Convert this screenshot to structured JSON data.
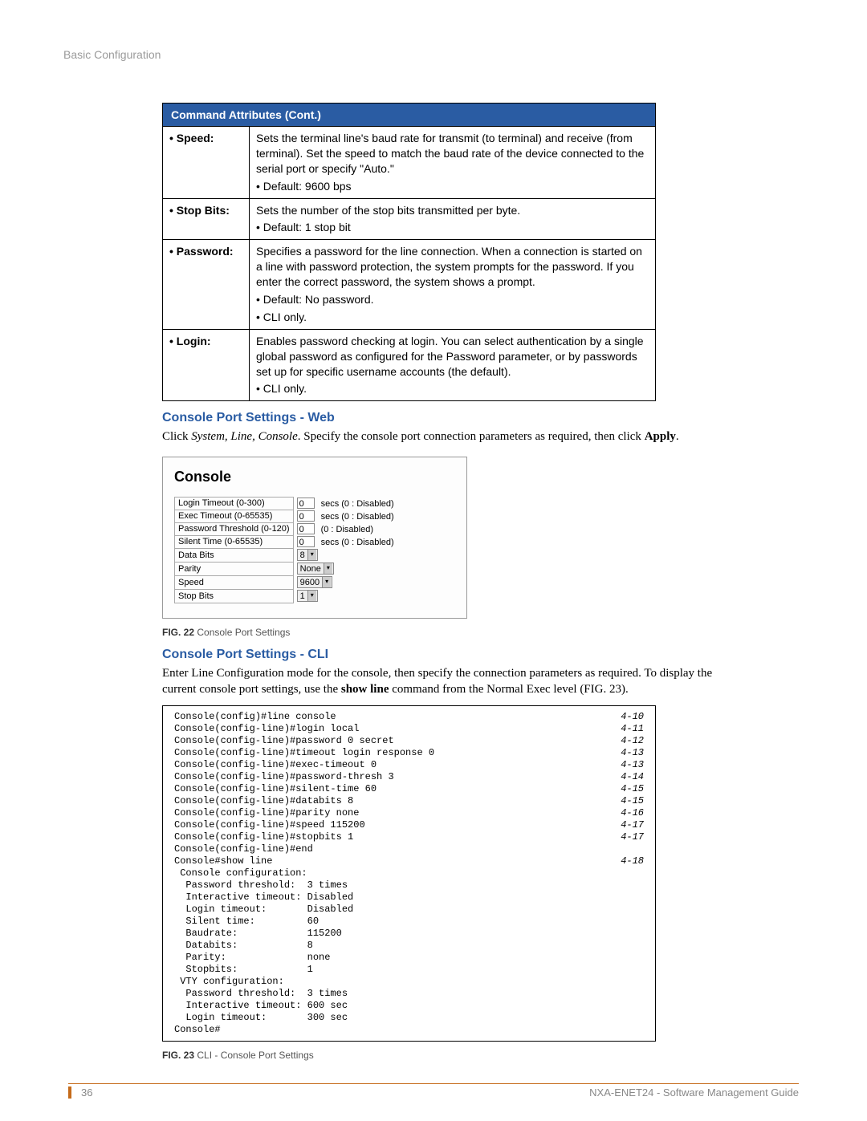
{
  "header": "Basic Configuration",
  "table_title": "Command Attributes (Cont.)",
  "rows": [
    {
      "label": "• Speed:",
      "desc": "Sets the terminal line's baud rate for transmit (to terminal) and receive (from terminal). Set the speed to match the baud rate of the device connected to the serial port or specify \"Auto.\"",
      "bul1": "• Default: 9600 bps",
      "bul2": ""
    },
    {
      "label": "• Stop Bits:",
      "desc": "Sets the number of the stop bits transmitted per byte.",
      "bul1": "• Default: 1 stop bit",
      "bul2": ""
    },
    {
      "label": "• Password:",
      "desc": "Specifies a password for the line connection. When a connection is started on a line with password protection, the system prompts for the password. If you enter the correct password, the system shows a prompt.",
      "bul1": "• Default: No password.",
      "bul2": "• CLI only."
    },
    {
      "label": "• Login:",
      "desc": "Enables password checking at login. You can select authentication by a single global password as configured for the Password parameter, or by passwords set up for specific username accounts (the default).",
      "bul1": "• CLI only.",
      "bul2": ""
    }
  ],
  "sec_web_title": "Console Port Settings - Web",
  "sec_web_body_pre": "Click ",
  "sec_web_body_ital": "System, Line, Console",
  "sec_web_body_post": ". Specify the console port connection parameters as required, then click ",
  "sec_web_body_bold": "Apply",
  "sec_web_body_end": ".",
  "console_title": "Console",
  "form": [
    {
      "label": "Login Timeout (0-300)",
      "val": "0",
      "suffix": "secs (0 : Disabled)",
      "type": "input"
    },
    {
      "label": "Exec Timeout (0-65535)",
      "val": "0",
      "suffix": "secs (0 : Disabled)",
      "type": "input"
    },
    {
      "label": "Password Threshold (0-120)",
      "val": "0",
      "suffix": "(0 : Disabled)",
      "type": "input"
    },
    {
      "label": "Silent Time (0-65535)",
      "val": "0",
      "suffix": "secs (0 : Disabled)",
      "type": "input"
    },
    {
      "label": "Data Bits",
      "val": "8",
      "suffix": "",
      "type": "select"
    },
    {
      "label": "Parity",
      "val": "None",
      "suffix": "",
      "type": "select"
    },
    {
      "label": "Speed",
      "val": "9600",
      "suffix": "",
      "type": "select"
    },
    {
      "label": "Stop Bits",
      "val": "1",
      "suffix": "",
      "type": "select"
    }
  ],
  "fig22_label": "FIG. 22",
  "fig22_text": "  Console Port Settings",
  "sec_cli_title": "Console Port Settings - CLI",
  "sec_cli_body_1": "Enter Line Configuration mode for the console, then specify the connection parameters as required. To display the current console port settings, use the ",
  "sec_cli_body_bold": "show line",
  "sec_cli_body_2": " command from the Normal Exec level (FIG. 23).",
  "cli": [
    {
      "cmd": "Console(config)#line console",
      "ref": "4-10"
    },
    {
      "cmd": "Console(config-line)#login local",
      "ref": "4-11"
    },
    {
      "cmd": "Console(config-line)#password 0 secret",
      "ref": "4-12"
    },
    {
      "cmd": "Console(config-line)#timeout login response 0",
      "ref": "4-13"
    },
    {
      "cmd": "Console(config-line)#exec-timeout 0",
      "ref": "4-13"
    },
    {
      "cmd": "Console(config-line)#password-thresh 3",
      "ref": "4-14"
    },
    {
      "cmd": "Console(config-line)#silent-time 60",
      "ref": "4-15"
    },
    {
      "cmd": "Console(config-line)#databits 8",
      "ref": "4-15"
    },
    {
      "cmd": "Console(config-line)#parity none",
      "ref": "4-16"
    },
    {
      "cmd": "Console(config-line)#speed 115200",
      "ref": "4-17"
    },
    {
      "cmd": "Console(config-line)#stopbits 1",
      "ref": "4-17"
    },
    {
      "cmd": "Console(config-line)#end",
      "ref": ""
    },
    {
      "cmd": "Console#show line",
      "ref": "4-18"
    },
    {
      "cmd": " Console configuration:",
      "ref": ""
    },
    {
      "cmd": "  Password threshold:  3 times",
      "ref": ""
    },
    {
      "cmd": "  Interactive timeout: Disabled",
      "ref": ""
    },
    {
      "cmd": "  Login timeout:       Disabled",
      "ref": ""
    },
    {
      "cmd": "  Silent time:         60",
      "ref": ""
    },
    {
      "cmd": "  Baudrate:            115200",
      "ref": ""
    },
    {
      "cmd": "  Databits:            8",
      "ref": ""
    },
    {
      "cmd": "  Parity:              none",
      "ref": ""
    },
    {
      "cmd": "  Stopbits:            1",
      "ref": ""
    },
    {
      "cmd": "",
      "ref": ""
    },
    {
      "cmd": " VTY configuration:",
      "ref": ""
    },
    {
      "cmd": "  Password threshold:  3 times",
      "ref": ""
    },
    {
      "cmd": "  Interactive timeout: 600 sec",
      "ref": ""
    },
    {
      "cmd": "  Login timeout:       300 sec",
      "ref": ""
    },
    {
      "cmd": "Console#",
      "ref": ""
    }
  ],
  "fig23_label": "FIG. 23",
  "fig23_text": "  CLI - Console Port Settings",
  "footer_page": "36",
  "footer_doc": "NXA-ENET24 - Software Management Guide"
}
